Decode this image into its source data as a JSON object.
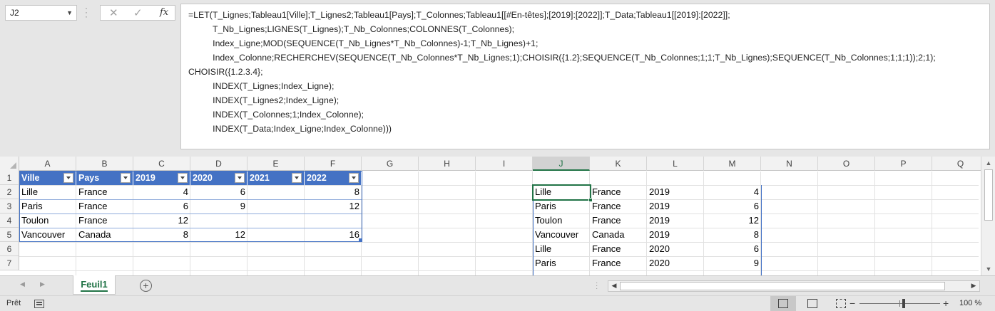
{
  "name_box": {
    "value": "J2"
  },
  "formula_bar": {
    "cancel_icon": "✕",
    "enter_icon": "✓",
    "fx_label": "fx",
    "formula": "=LET(T_Lignes;Tableau1[Ville];T_Lignes2;Tableau1[Pays];T_Colonnes;Tableau1[[#En-têtes];[2019]:[2022]];T_Data;Tableau1[[2019]:[2022]];\n          T_Nb_Lignes;LIGNES(T_Lignes);T_Nb_Colonnes;COLONNES(T_Colonnes);\n          Index_Ligne;MOD(SEQUENCE(T_Nb_Lignes*T_Nb_Colonnes)-1;T_Nb_Lignes)+1;\n          Index_Colonne;RECHERCHEV(SEQUENCE(T_Nb_Colonnes*T_Nb_Lignes;1);CHOISIR({1.2};SEQUENCE(T_Nb_Colonnes;1;1;T_Nb_Lignes);SEQUENCE(T_Nb_Colonnes;1;1;1));2;1);\nCHOISIR({1.2.3.4};\n          INDEX(T_Lignes;Index_Ligne);\n          INDEX(T_Lignes2;Index_Ligne);\n          INDEX(T_Colonnes;1;Index_Colonne);\n          INDEX(T_Data;Index_Ligne;Index_Colonne)))"
  },
  "columns": [
    "A",
    "B",
    "C",
    "D",
    "E",
    "F",
    "G",
    "H",
    "I",
    "J",
    "K",
    "L",
    "M",
    "N",
    "O",
    "P",
    "Q"
  ],
  "rows": [
    "1",
    "2",
    "3",
    "4",
    "5",
    "6",
    "7"
  ],
  "source_table": {
    "headers": [
      "Ville",
      "Pays",
      "2019",
      "2020",
      "2021",
      "2022"
    ],
    "rows": [
      [
        "Lille",
        "France",
        "4",
        "6",
        "",
        "8"
      ],
      [
        "Paris",
        "France",
        "6",
        "9",
        "",
        "12"
      ],
      [
        "Toulon",
        "France",
        "12",
        "",
        "",
        ""
      ],
      [
        "Vancouver",
        "Canada",
        "8",
        "12",
        "",
        "16"
      ]
    ]
  },
  "spill_result": {
    "rows": [
      [
        "Lille",
        "France",
        "2019",
        "4"
      ],
      [
        "Paris",
        "France",
        "2019",
        "6"
      ],
      [
        "Toulon",
        "France",
        "2019",
        "12"
      ],
      [
        "Vancouver",
        "Canada",
        "2019",
        "8"
      ],
      [
        "Lille",
        "France",
        "2020",
        "6"
      ],
      [
        "Paris",
        "France",
        "2020",
        "9"
      ]
    ]
  },
  "sheet_tabs": {
    "active": "Feuil1",
    "add_label": "+"
  },
  "status_bar": {
    "ready": "Prêt",
    "zoom": "100 %"
  },
  "colors": {
    "table_header": "#4472c4",
    "accent": "#217346"
  }
}
